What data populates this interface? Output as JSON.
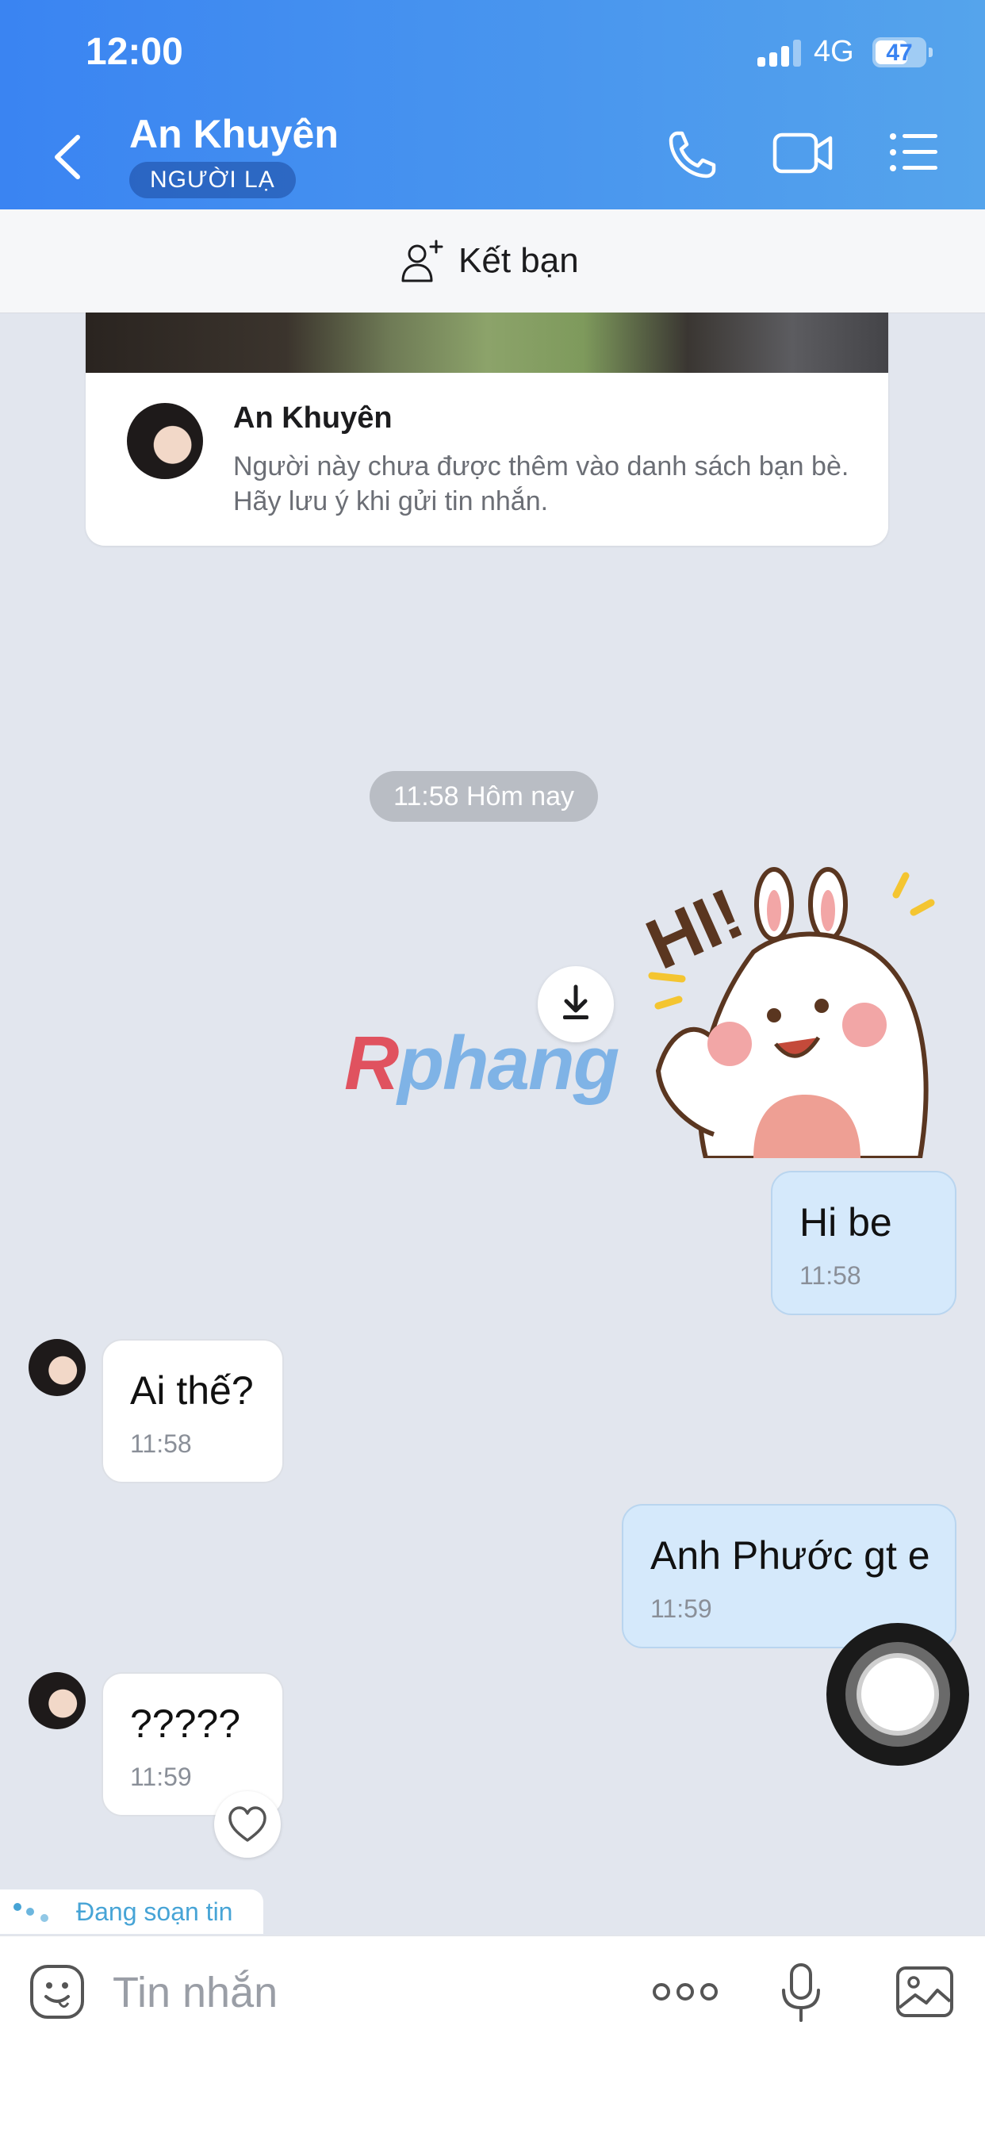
{
  "status_bar": {
    "time": "12:00",
    "network": "4G",
    "battery": "47"
  },
  "header": {
    "contact_name": "An Khuyên",
    "badge": "NGƯỜI LẠ",
    "icons": [
      "back-icon",
      "phone-icon",
      "video-call-icon",
      "menu-list-icon"
    ]
  },
  "add_friend": {
    "label": "Kết bạn",
    "icon": "add-person-icon"
  },
  "profile_card": {
    "name": "An Khuyên",
    "note": "Người này chưa được thêm vào danh sách bạn bè. Hãy lưu ý khi gửi tin nhắn."
  },
  "date_separator": "11:58 Hôm nay",
  "sticker": {
    "text": "HI!",
    "watermark_first": "R",
    "watermark_rest": "phang"
  },
  "messages": [
    {
      "direction": "out",
      "text": "Hi be",
      "time": "11:58"
    },
    {
      "direction": "in",
      "text": "Ai thế?",
      "time": "11:58"
    },
    {
      "direction": "out",
      "text": "Anh Phước gt e",
      "time": "11:59"
    },
    {
      "direction": "in",
      "text": "?????",
      "time": "11:59"
    }
  ],
  "typing_indicator": "Đang soạn tin",
  "composer": {
    "placeholder": "Tin nhắn",
    "icons": [
      "emoji-icon",
      "more-icon",
      "microphone-icon",
      "image-icon"
    ]
  },
  "colors": {
    "header_start": "#3a84f2",
    "header_end": "#55a4ec",
    "outgoing_bubble": "#d5e9fb",
    "incoming_bubble": "#ffffff",
    "chat_background": "#e2e6ee",
    "typing_text": "#47a4d6"
  }
}
